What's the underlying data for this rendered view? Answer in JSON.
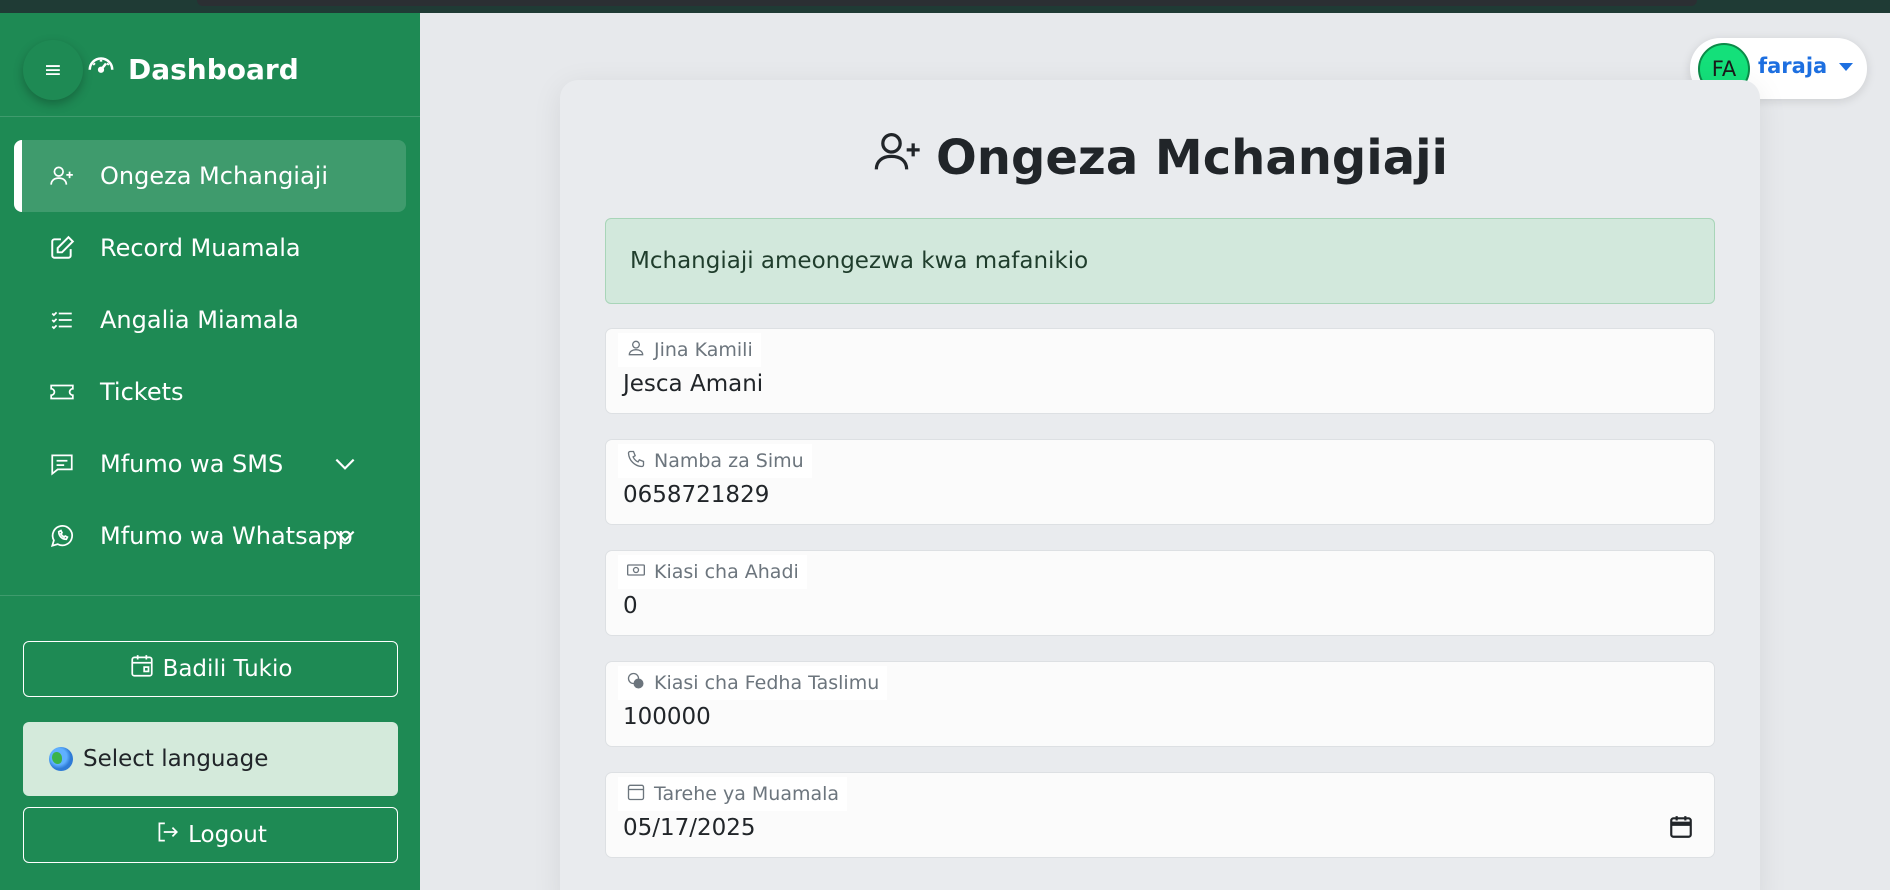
{
  "sidebar": {
    "brand": "Dashboard",
    "items": [
      {
        "label": "Ongeza Mchangiaji",
        "icon": "user-plus-icon",
        "active": true
      },
      {
        "label": "Record Muamala",
        "icon": "edit-icon"
      },
      {
        "label": "Angalia Miamala",
        "icon": "list-check-icon"
      },
      {
        "label": "Tickets",
        "icon": "ticket-icon"
      },
      {
        "label": "Mfumo wa SMS",
        "icon": "message-icon",
        "expandable": true
      },
      {
        "label": "Mfumo wa Whatsapp",
        "icon": "whatsapp-icon",
        "expandable": true
      }
    ],
    "change_event_label": "Badili Tukio",
    "language_label": "Select language",
    "logout_label": "Logout"
  },
  "user": {
    "initials": "FA",
    "name": "faraja"
  },
  "form": {
    "title": "Ongeza Mchangiaji",
    "alert": "Mchangiaji ameongezwa kwa mafanikio",
    "fields": [
      {
        "label": "Jina Kamili",
        "value": "Jesca Amani",
        "icon": "person-icon"
      },
      {
        "label": "Namba za Simu",
        "value": "0658721829",
        "icon": "phone-icon"
      },
      {
        "label": "Kiasi cha Ahadi",
        "value": "0",
        "icon": "cash-icon"
      },
      {
        "label": "Kiasi cha Fedha Taslimu",
        "value": "100000",
        "icon": "coins-icon"
      },
      {
        "label": "Tarehe ya Muamala",
        "value": "05/17/2025",
        "icon": "calendar-icon"
      }
    ]
  },
  "colors": {
    "sidebar": "#1e8a54",
    "accent": "#1d6fe0",
    "alert_bg": "#d2e8dc",
    "avatar": "#14e07a"
  }
}
